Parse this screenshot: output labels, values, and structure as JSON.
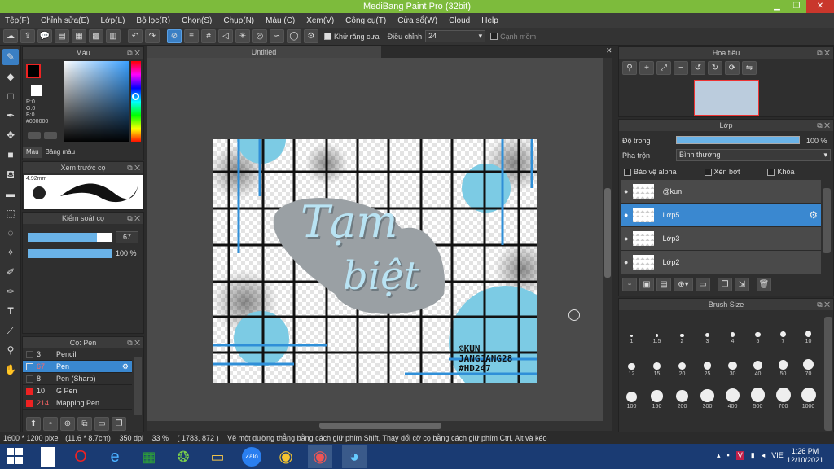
{
  "window": {
    "title": "MediBang Paint Pro (32bit)"
  },
  "menu": [
    "Tệp(F)",
    "Chỉnh sửa(E)",
    "Lớp(L)",
    "Bộ lọc(R)",
    "Chọn(S)",
    "Chụp(N)",
    "Màu (C)",
    "Xem(V)",
    "Công cụ(T)",
    "Cửa sổ(W)",
    "Cloud",
    "Help"
  ],
  "toolbar": {
    "antialias_label": "Khử răng cưa",
    "adjust_label": "Điều chỉnh",
    "adjust_value": "24",
    "edge_label": "Cạnh mềm"
  },
  "color_panel": {
    "title": "Màu",
    "r": "R:0",
    "g": "G:0",
    "b": "B:0",
    "hex": "#000000",
    "tab_color": "Màu",
    "tab_palette": "Bảng màu"
  },
  "brush_preview": {
    "title": "Xem trước cọ",
    "size": "4.92mm"
  },
  "brush_control": {
    "title": "Kiểm soát cọ",
    "size_value": "67",
    "opacity_value": "100 %",
    "size_fraction": 0.82,
    "opacity_fraction": 1.0
  },
  "brush_list": {
    "title": "Cọ: Pen",
    "items": [
      {
        "num": "3",
        "name": "Pencil",
        "color": "#2f2f2f"
      },
      {
        "num": "67",
        "name": "Pen",
        "color": "#2f2f2f"
      },
      {
        "num": "8",
        "name": "Pen (Sharp)",
        "color": "#2f2f2f"
      },
      {
        "num": "10",
        "name": "G Pen",
        "color": "#e22"
      },
      {
        "num": "214",
        "name": "Mapping Pen",
        "color": "#e22"
      }
    ]
  },
  "document": {
    "tab": "Untitled"
  },
  "artwork": {
    "title_line1": "Tạm",
    "title_line2": "biệt",
    "tag1": "@KUN",
    "tag2": "JANGJANG28",
    "tag3": "#HD247"
  },
  "navigator": {
    "title": "Hoa tiêu"
  },
  "layer_panel": {
    "title": "Lớp",
    "opacity_label": "Độ trong",
    "opacity_value": "100 %",
    "blend_label": "Pha trộn",
    "blend_value": "Bình thường",
    "protect_alpha": "Bảo vệ alpha",
    "clip": "Xén bớt",
    "lock": "Khóa",
    "layers": [
      {
        "name": "@kun",
        "selected": false
      },
      {
        "name": "Lớp5",
        "selected": true
      },
      {
        "name": "Lớp3",
        "selected": false
      },
      {
        "name": "Lớp2",
        "selected": false
      }
    ]
  },
  "brush_size": {
    "title": "Brush Size",
    "sizes": [
      "1",
      "1.5",
      "2",
      "3",
      "4",
      "5",
      "7",
      "10",
      "12",
      "15",
      "20",
      "25",
      "30",
      "40",
      "50",
      "70",
      "100",
      "150",
      "200",
      "300",
      "400",
      "500",
      "700",
      "1000"
    ]
  },
  "status": {
    "dimensions": "1600 * 1200 pixel",
    "physical": "(11.6 * 8.7cm)",
    "dpi": "350 dpi",
    "zoom": "33 %",
    "coords": "( 1783, 872 )",
    "hint": "Vẽ một đường thẳng bằng cách giữ phím Shift, Thay đổi cỡ cọ bằng cách giữ phím Ctrl, Alt và kéo"
  },
  "taskbar": {
    "lang": "VIE",
    "time": "1:26 PM",
    "date": "12/10/2021"
  }
}
